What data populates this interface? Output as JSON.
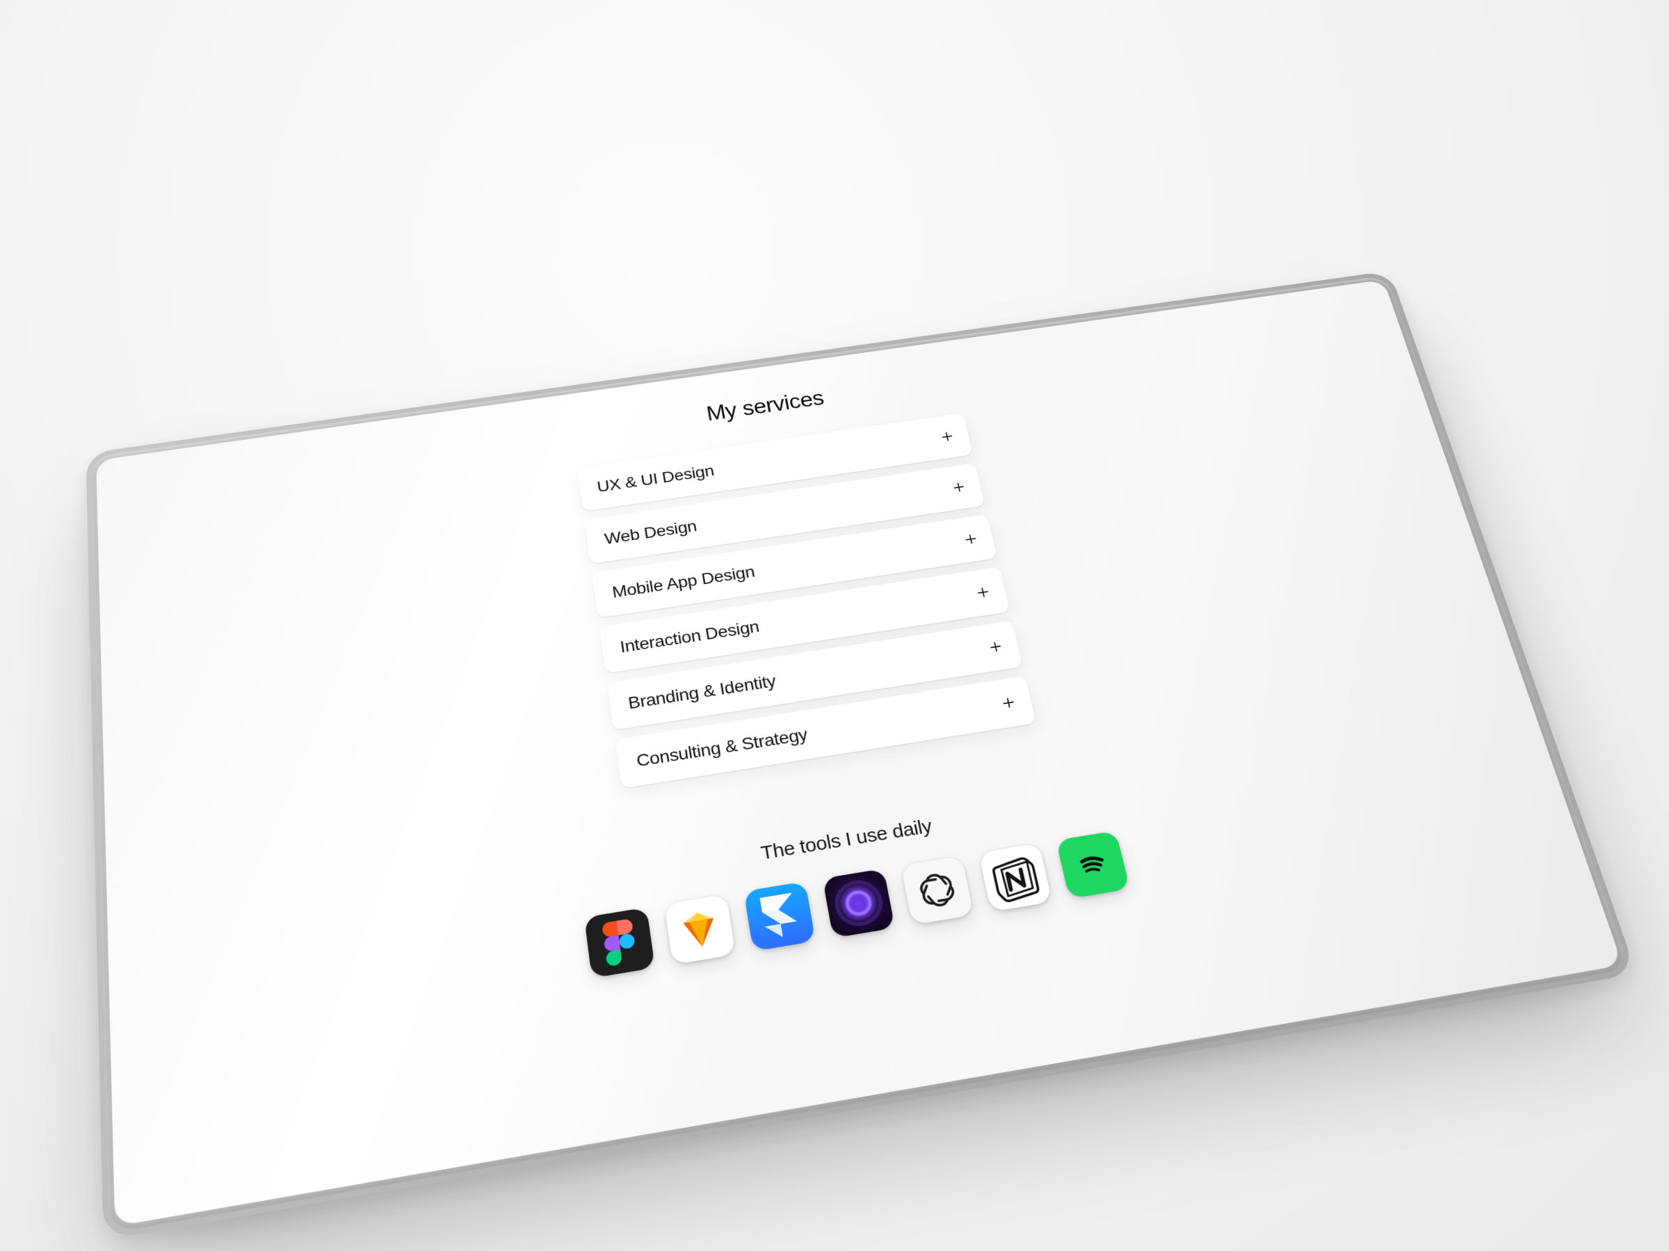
{
  "services": {
    "heading": "My services",
    "items": [
      {
        "label": "UX & UI Design"
      },
      {
        "label": "Web Design"
      },
      {
        "label": "Mobile App Design"
      },
      {
        "label": "Interaction Design"
      },
      {
        "label": "Branding & Identity"
      },
      {
        "label": "Consulting & Strategy"
      }
    ]
  },
  "tools": {
    "heading": "The tools I use daily",
    "apps": [
      {
        "name": "figma-icon"
      },
      {
        "name": "sketch-icon"
      },
      {
        "name": "framer-icon"
      },
      {
        "name": "circle-app-icon"
      },
      {
        "name": "openai-icon"
      },
      {
        "name": "notion-icon"
      },
      {
        "name": "spotify-icon"
      }
    ]
  }
}
